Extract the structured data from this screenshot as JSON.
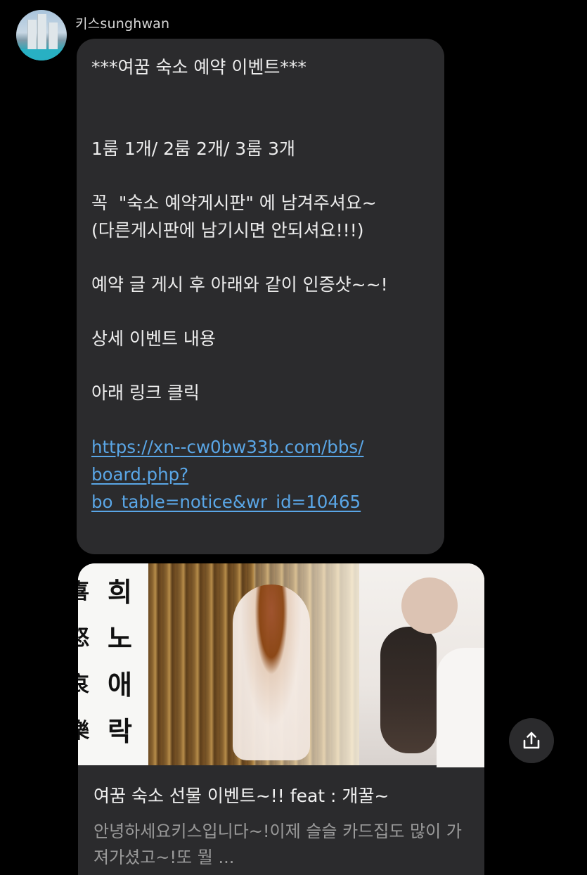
{
  "sender": {
    "name": "키스sunghwan"
  },
  "message": {
    "lines": [
      "***여꿈 숙소 예약 이벤트***",
      "",
      "",
      "1룸 1개/ 2룸 2개/ 3룸 3개",
      "",
      "꼭  \"숙소 예약게시판\" 에 남겨주셔요~",
      "(다른게시판에 남기시면 안되셔요!!!)",
      "",
      "예약 글 게시 후 아래와 같이 인증샷~~!",
      "",
      "상세 이벤트 내용",
      "",
      "아래 링크 클릭",
      ""
    ],
    "link_lines": [
      "https://xn--cw0bw33b.com/bbs/",
      "board.php?",
      "bo_table=notice&wr_id=10465"
    ]
  },
  "link_preview": {
    "calligraphy_left": [
      "喜",
      "怒",
      "哀",
      "樂"
    ],
    "calligraphy_right": [
      "희",
      "노",
      "애",
      "락"
    ],
    "title": "여꿈 숙소 선물 이벤트~!! feat : 개꿀~",
    "description": "안녕하세요키스입니다~!이제 슬슬 카드집도 많이 가져가셨고~!또 뭘 ..."
  },
  "icons": {
    "avatar": "profile-photo",
    "share": "share-icon"
  }
}
